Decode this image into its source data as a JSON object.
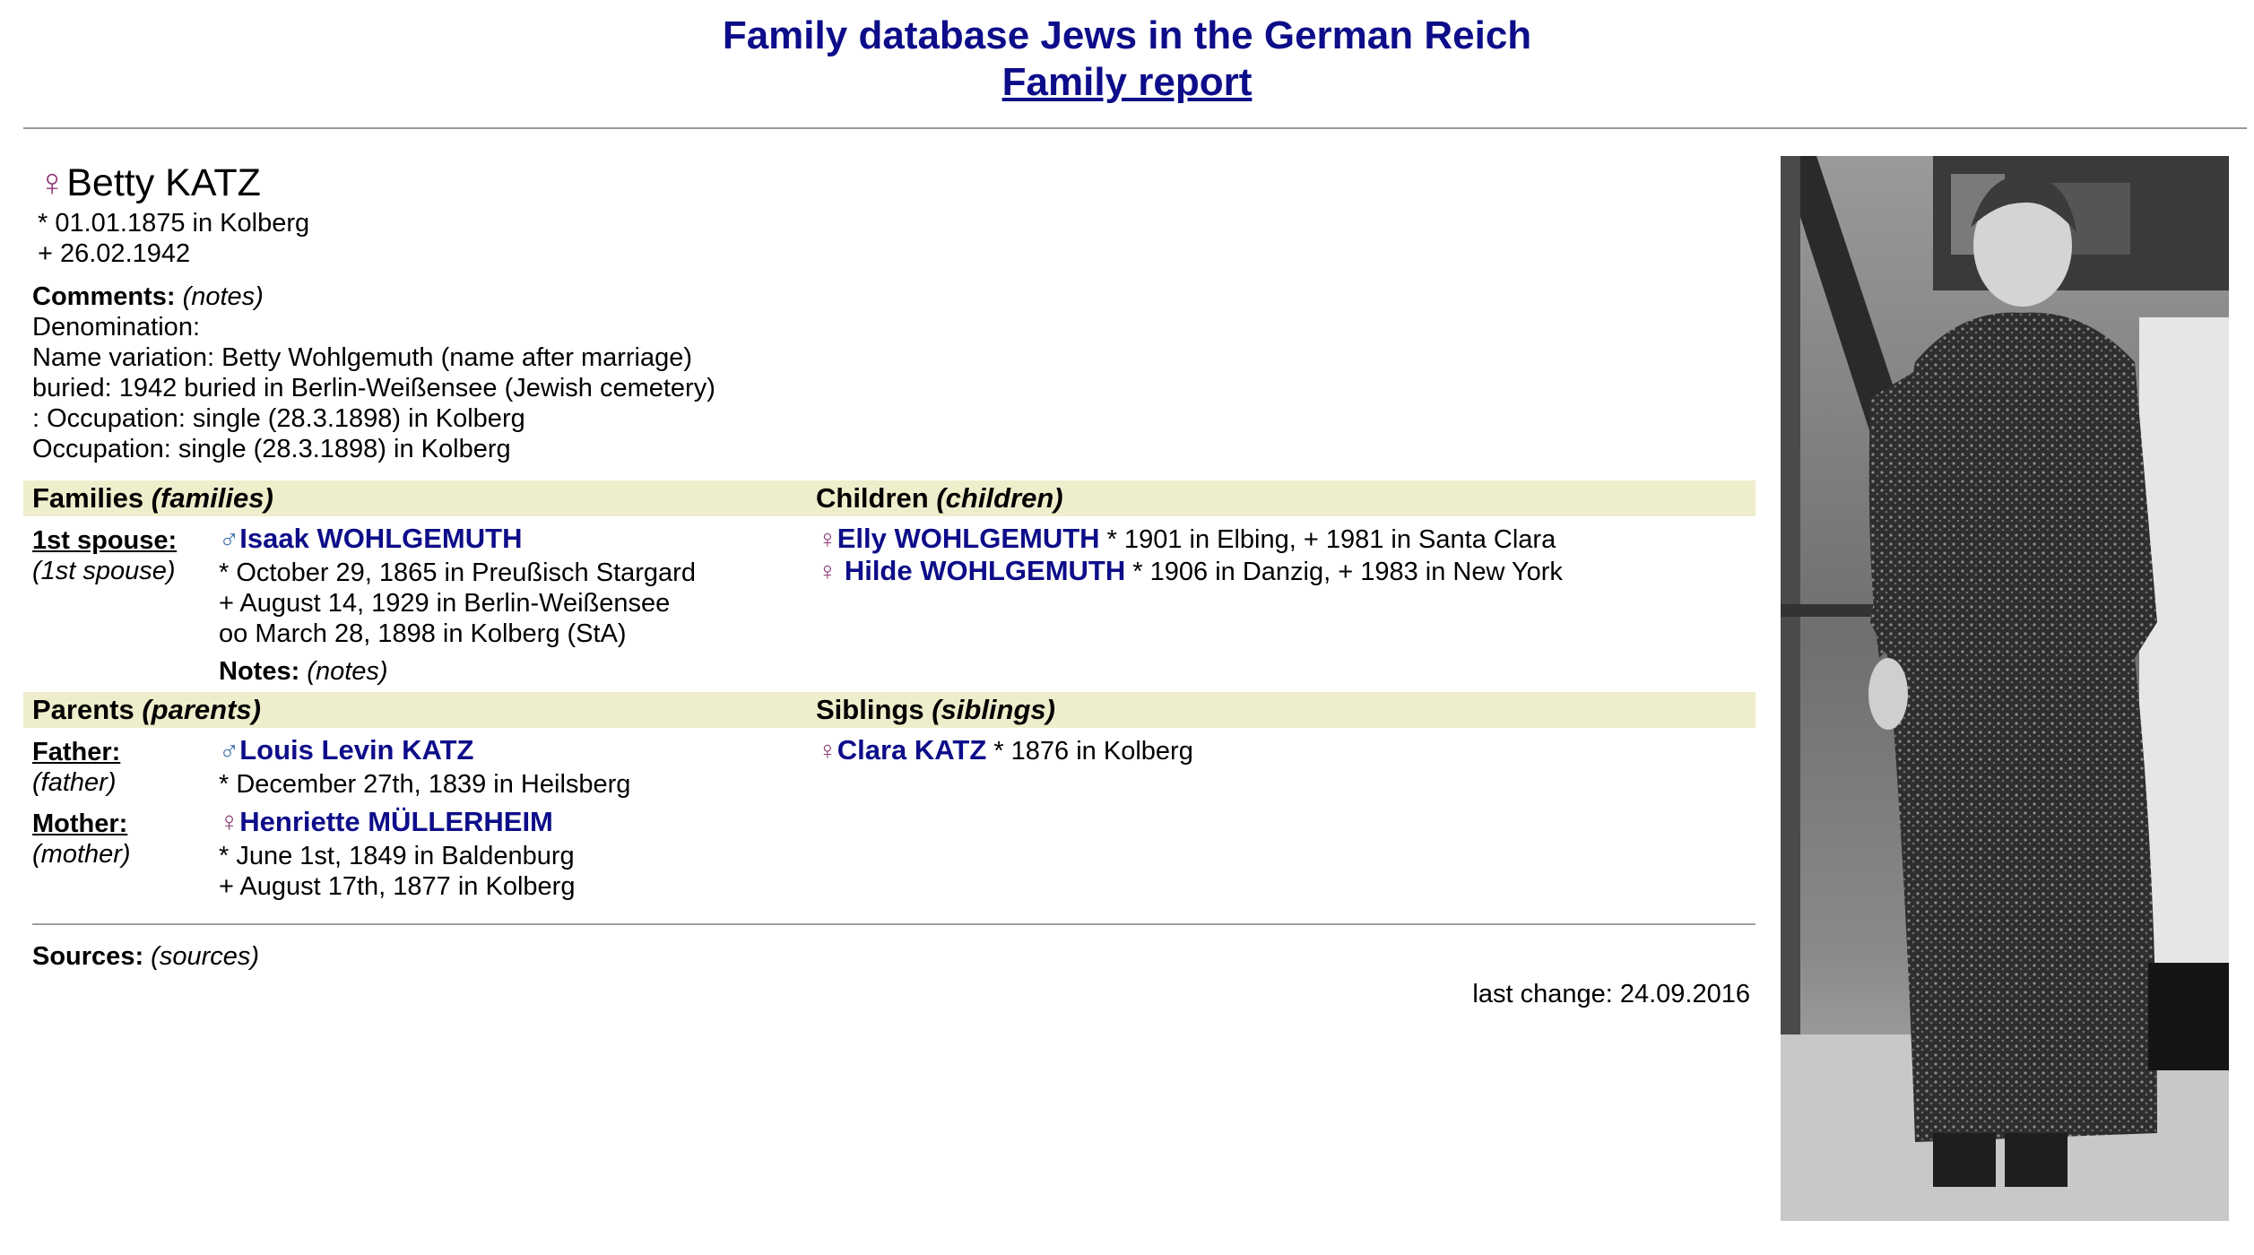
{
  "header": {
    "title": "Family database Jews in the German Reich",
    "subtitle": "Family report"
  },
  "person": {
    "gender_symbol": "♀",
    "name": "Betty KATZ",
    "birth": "* 01.01.1875 in Kolberg",
    "death": "+ 26.02.1942"
  },
  "comments": {
    "label": "Comments:",
    "notes": "(notes)",
    "lines": [
      "Denomination:",
      "Name variation: Betty Wohlgemuth (name after marriage)",
      "buried: 1942 buried in Berlin-Weißensee (Jewish cemetery)",
      ": Occupation: single (28.3.1898) in Kolberg",
      "Occupation: single (28.3.1898) in Kolberg"
    ]
  },
  "families": {
    "heading": "Families",
    "heading_sub": "(families)",
    "spouse_label": "1st spouse:",
    "spouse_sub": "(1st spouse)",
    "spouse": {
      "symbol": "♂",
      "name": "Isaak WOHLGEMUTH",
      "lines": [
        "* October 29, 1865 in Preußisch Stargard",
        "+ August 14, 1929 in Berlin-Weißensee",
        "oo March 28, 1898 in Kolberg (StA)"
      ],
      "notes_label": "Notes:",
      "notes": "(notes)"
    }
  },
  "children": {
    "heading": "Children",
    "heading_sub": "(children)",
    "items": [
      {
        "symbol": "♀",
        "name": "Elly WOHLGEMUTH",
        "info": "* 1901 in Elbing, + 1981 in Santa Clara"
      },
      {
        "symbol": "♀",
        "name": "Hilde WOHLGEMUTH",
        "info": "* 1906 in Danzig, + 1983 in New York"
      }
    ]
  },
  "parents": {
    "heading": "Parents",
    "heading_sub": "(parents)",
    "father_label": "Father:",
    "father_sub": "(father)",
    "father": {
      "symbol": "♂",
      "name": "Louis Levin KATZ",
      "lines": [
        "* December 27th, 1839 in Heilsberg"
      ]
    },
    "mother_label": "Mother:",
    "mother_sub": "(mother)",
    "mother": {
      "symbol": "♀",
      "name": "Henriette MÜLLERHEIM",
      "lines": [
        "* June 1st, 1849 in Baldenburg",
        "+ August 17th, 1877 in Kolberg"
      ]
    }
  },
  "siblings": {
    "heading": "Siblings",
    "heading_sub": "(siblings)",
    "items": [
      {
        "symbol": "♀",
        "name": "Clara KATZ",
        "info": "* 1876 in Kolberg"
      }
    ]
  },
  "sources": {
    "label": "Sources:",
    "value": "(sources)"
  },
  "last_change": "last change: 24.09.2016",
  "colors": {
    "link": "#0d0d8a",
    "female": "#8e3b77",
    "male": "#3f6fa8",
    "section_bg": "#eeeecc"
  }
}
